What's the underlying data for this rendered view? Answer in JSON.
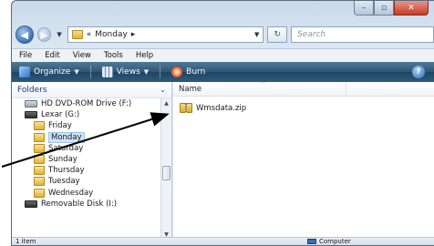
{
  "address": {
    "breadcrumb_prefix": "«",
    "current_folder": "Monday",
    "separator_arrow": "▸"
  },
  "search": {
    "placeholder": "Search"
  },
  "menu": [
    "File",
    "Edit",
    "View",
    "Tools",
    "Help"
  ],
  "commands": {
    "organize": "Organize",
    "views": "Views",
    "burn": "Burn"
  },
  "folders_pane": {
    "header": "Folders",
    "items": [
      {
        "label": "HD DVD-ROM Drive (F:)",
        "icon": "dvd-drive-icon",
        "indent": 1
      },
      {
        "label": "Lexar (G:)",
        "icon": "removable-drive-icon",
        "indent": 1
      },
      {
        "label": "Friday",
        "icon": "folder-icon",
        "indent": 2
      },
      {
        "label": "Monday",
        "icon": "folder-icon",
        "indent": 2,
        "selected": true
      },
      {
        "label": "Saturday",
        "icon": "folder-icon",
        "indent": 2
      },
      {
        "label": "Sunday",
        "icon": "folder-icon",
        "indent": 2
      },
      {
        "label": "Thursday",
        "icon": "folder-icon",
        "indent": 2
      },
      {
        "label": "Tuesday",
        "icon": "folder-icon",
        "indent": 2
      },
      {
        "label": "Wednesday",
        "icon": "folder-icon",
        "indent": 2
      },
      {
        "label": "Removable Disk (I:)",
        "icon": "removable-drive-icon",
        "indent": 1
      }
    ]
  },
  "file_list": {
    "column_name": "Name",
    "files": [
      {
        "name": "Wmsdata.zip",
        "icon": "zip-folder-icon"
      }
    ]
  },
  "status": {
    "item_count": "1 item",
    "location": "Computer"
  },
  "colors": {
    "command_bar": "#2d5b7b",
    "selection": "#cfe3f7",
    "close_button": "#c43d27"
  }
}
